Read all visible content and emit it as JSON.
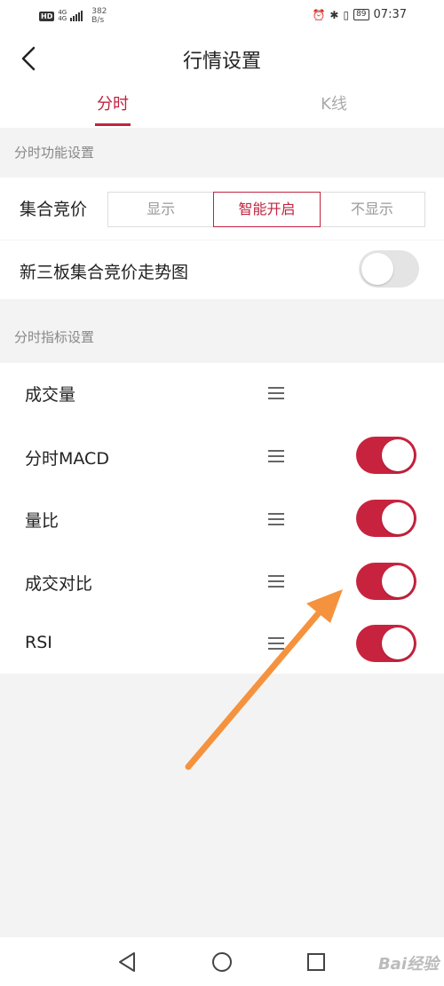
{
  "status_bar": {
    "hd": "HD",
    "net_top": "4G",
    "net_bottom": "4G",
    "speed_value": "382",
    "speed_unit": "B/s",
    "battery": "89",
    "time": "07:37"
  },
  "header": {
    "title": "行情设置",
    "back_icon": "chevron-left-icon"
  },
  "tabs": [
    {
      "label": "分时",
      "active": true
    },
    {
      "label": "K线",
      "active": false
    }
  ],
  "function_section": {
    "heading": "分时功能设置",
    "auction": {
      "label": "集合竞价",
      "options": [
        "显示",
        "智能开启",
        "不显示"
      ],
      "selected": "智能开启"
    },
    "neeq_chart": {
      "label": "新三板集合竞价走势图",
      "enabled": false
    }
  },
  "indicator_section": {
    "heading": "分时指标设置",
    "items": [
      {
        "label": "成交量",
        "has_toggle": false,
        "enabled": true
      },
      {
        "label": "分时MACD",
        "has_toggle": true,
        "enabled": true
      },
      {
        "label": "量比",
        "has_toggle": true,
        "enabled": true
      },
      {
        "label": "成交对比",
        "has_toggle": true,
        "enabled": true
      },
      {
        "label": "RSI",
        "has_toggle": true,
        "enabled": true
      }
    ]
  },
  "colors": {
    "accent": "#c0243f",
    "toggle_on": "#c8233e",
    "toggle_off": "#e4e4e4",
    "arrow": "#f5923e"
  },
  "watermark": "Bai经验"
}
